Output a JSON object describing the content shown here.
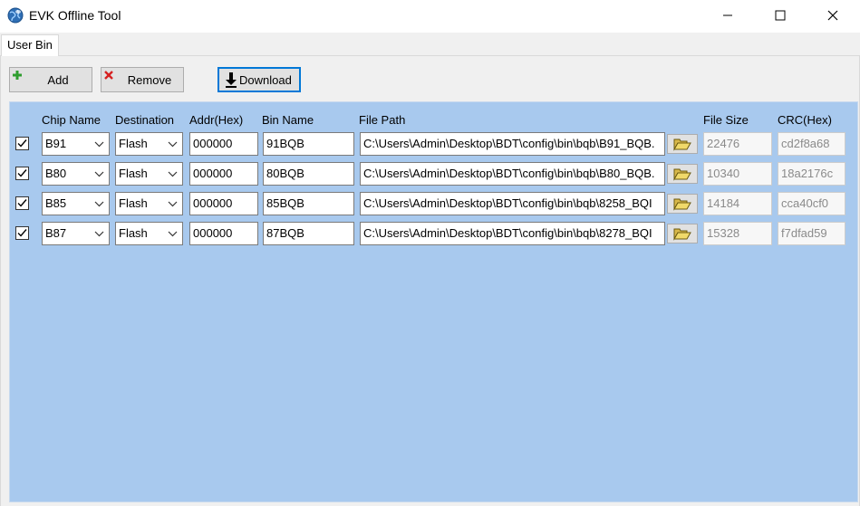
{
  "window": {
    "title": "EVK Offline Tool",
    "icon": "globe-icon",
    "controls": [
      "minimize-icon",
      "maximize-icon",
      "close-icon"
    ]
  },
  "tabs": [
    {
      "label": "User Bin",
      "active": true
    }
  ],
  "toolbar": {
    "add_label": "Add",
    "remove_label": "Remove",
    "download_label": "Download"
  },
  "headers": {
    "chip_name": "Chip Name",
    "destination": "Destination",
    "addr": "Addr(Hex)",
    "bin_name": "Bin Name",
    "file_path": "File Path",
    "file_size": "File Size",
    "crc": "CRC(Hex)"
  },
  "rows": [
    {
      "checked": true,
      "chip": "B91",
      "dest": "Flash",
      "addr": "000000",
      "bin": "91BQB",
      "path": "C:\\Users\\Admin\\Desktop\\BDT\\config\\bin\\bqb\\B91_BQB.",
      "size": "22476",
      "crc": "cd2f8a68"
    },
    {
      "checked": true,
      "chip": "B80",
      "dest": "Flash",
      "addr": "000000",
      "bin": "80BQB",
      "path": "C:\\Users\\Admin\\Desktop\\BDT\\config\\bin\\bqb\\B80_BQB.",
      "size": "10340",
      "crc": "18a2176c"
    },
    {
      "checked": true,
      "chip": "B85",
      "dest": "Flash",
      "addr": "000000",
      "bin": "85BQB",
      "path": "C:\\Users\\Admin\\Desktop\\BDT\\config\\bin\\bqb\\8258_BQI",
      "size": "14184",
      "crc": "cca40cf0"
    },
    {
      "checked": true,
      "chip": "B87",
      "dest": "Flash",
      "addr": "000000",
      "bin": "87BQB",
      "path": "C:\\Users\\Admin\\Desktop\\BDT\\config\\bin\\bqb\\8278_BQI",
      "size": "15328",
      "crc": "f7dfad59"
    }
  ],
  "colors": {
    "panel_bg": "#a8c9ee",
    "download_border": "#0078d7"
  }
}
